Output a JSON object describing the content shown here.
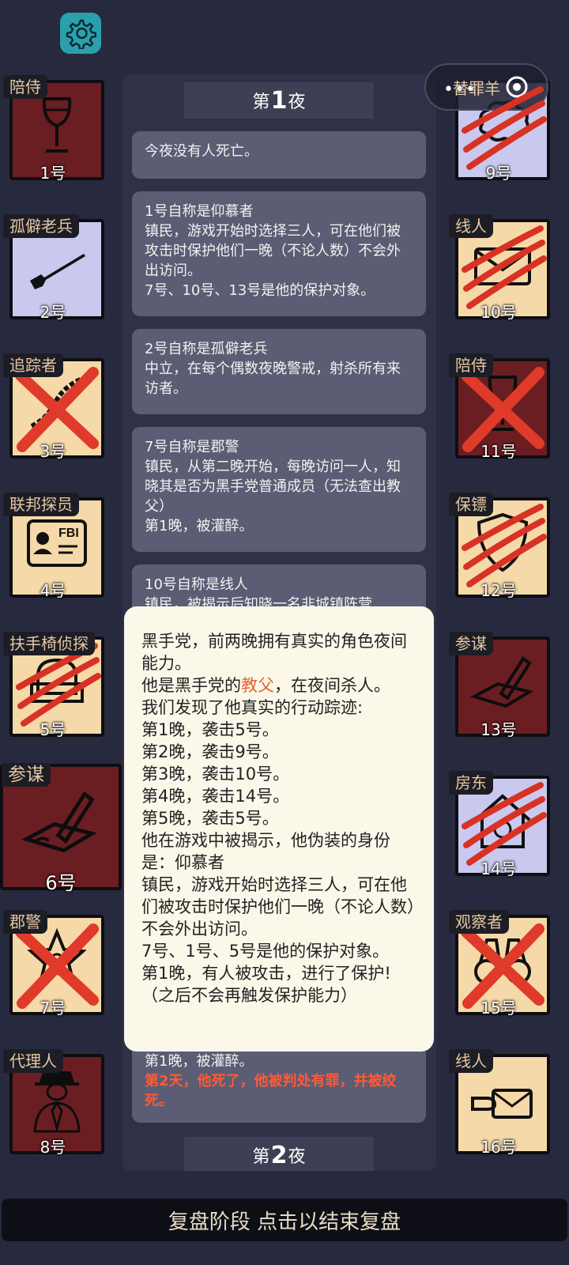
{
  "capsule": {
    "dots": "•••",
    "overlay_text": "替罪羊"
  },
  "players": [
    {
      "role": "陪侍",
      "num": "1号",
      "bg": "#6b1e22",
      "icon": "wine-glass-icon",
      "mark": "none"
    },
    {
      "role": "孤僻老兵",
      "num": "2号",
      "bg": "#c9c9ef",
      "icon": "rifle-icon",
      "mark": "none"
    },
    {
      "role": "追踪者",
      "num": "3号",
      "bg": "#f6d9a8",
      "icon": "rope-icon",
      "mark": "cross"
    },
    {
      "role": "联邦探员",
      "num": "4号",
      "bg": "#f6d9a8",
      "icon": "fbi-badge-icon",
      "mark": "none"
    },
    {
      "role": "扶手椅侦探",
      "num": "5号",
      "bg": "#f6d9a8",
      "icon": "armchair-icon",
      "mark": "claw"
    },
    {
      "role": "参谋",
      "num": "6号",
      "bg": "#6b1e22",
      "icon": "pen-paper-icon",
      "mark": "none"
    },
    {
      "role": "郡警",
      "num": "7号",
      "bg": "#f6d9a8",
      "icon": "sheriff-star-icon",
      "mark": "cross"
    },
    {
      "role": "代理人",
      "num": "8号",
      "bg": "#6b1e22",
      "icon": "mobster-icon",
      "mark": "none"
    },
    {
      "role": "替罪羊",
      "num": "9号",
      "bg": "#c9c9ef",
      "icon": "sheep-icon",
      "mark": "claw"
    },
    {
      "role": "线人",
      "num": "10号",
      "bg": "#f6d9a8",
      "icon": "envelope-icon",
      "mark": "claw"
    },
    {
      "role": "陪侍",
      "num": "11号",
      "bg": "#6b1e22",
      "icon": "wine-glass-icon",
      "mark": "cross"
    },
    {
      "role": "保镖",
      "num": "12号",
      "bg": "#f6d9a8",
      "icon": "shield-icon",
      "mark": "claw"
    },
    {
      "role": "参谋",
      "num": "13号",
      "bg": "#6b1e22",
      "icon": "pen-paper-icon",
      "mark": "none"
    },
    {
      "role": "房东",
      "num": "14号",
      "bg": "#c9c9ef",
      "icon": "house-icon",
      "mark": "claw"
    },
    {
      "role": "观察者",
      "num": "15号",
      "bg": "#f6d9a8",
      "icon": "binoculars-icon",
      "mark": "cross"
    },
    {
      "role": "线人",
      "num": "16号",
      "bg": "#f6d9a8",
      "icon": "envelope-hand-icon",
      "mark": "none"
    }
  ],
  "log": {
    "night1": {
      "prefix": "第",
      "number": "1",
      "suffix": "夜"
    },
    "night2": {
      "prefix": "第",
      "number": "2",
      "suffix": "夜"
    },
    "messages": [
      [
        "今夜没有人死亡。"
      ],
      [
        "1号自称是仰慕者",
        "镇民，游戏开始时选择三人，可在他们被攻击时保护他们一晚（不论人数）不会外出访问。",
        "7号、10号、13号是他的保护对象。"
      ],
      [
        "2号自称是孤僻老兵",
        "中立，在每个偶数夜晚警戒，射杀所有来访者。"
      ],
      [
        "7号自称是郡警",
        "镇民，从第二晚开始，每晚访问一人，知晓其是否为黑手党普通成员（无法查出教父）",
        "第1晚，被灌醉。"
      ],
      [
        "10号自称是线人",
        "镇民，被揭示后知晓一名非城镇阵营"
      ],
      [
        "第1晚，被灌醉。"
      ]
    ],
    "death_note": "第2天，他死了，他被判处有罪，并被绞死。"
  },
  "popup": {
    "line1": "黑手党，前两晚拥有真实的角色夜间能力。",
    "line2_before": "他是黑手党的",
    "line2_highlight": "教父",
    "line2_after": "，在夜间杀人。",
    "line3": "我们发现了他真实的行动踪迹:",
    "tracks": [
      "第1晚，袭击5号。",
      "第2晚，袭击9号。",
      "第3晚，袭击10号。",
      "第4晚，袭击14号。",
      "第5晚，袭击5号。"
    ],
    "line4": "他在游戏中被揭示，他伪装的身份是：仰慕者",
    "line5": "镇民，游戏开始时选择三人，可在他们被攻击时保护他们一晚（不论人数）不会外出访问。",
    "line6": "7号、1号、5号是他的保护对象。",
    "line7": "第1晚，有人被攻击，进行了保护!（之后不会再触发保护能力）"
  },
  "bottom_bar": "复盘阶段 点击以结束复盘"
}
